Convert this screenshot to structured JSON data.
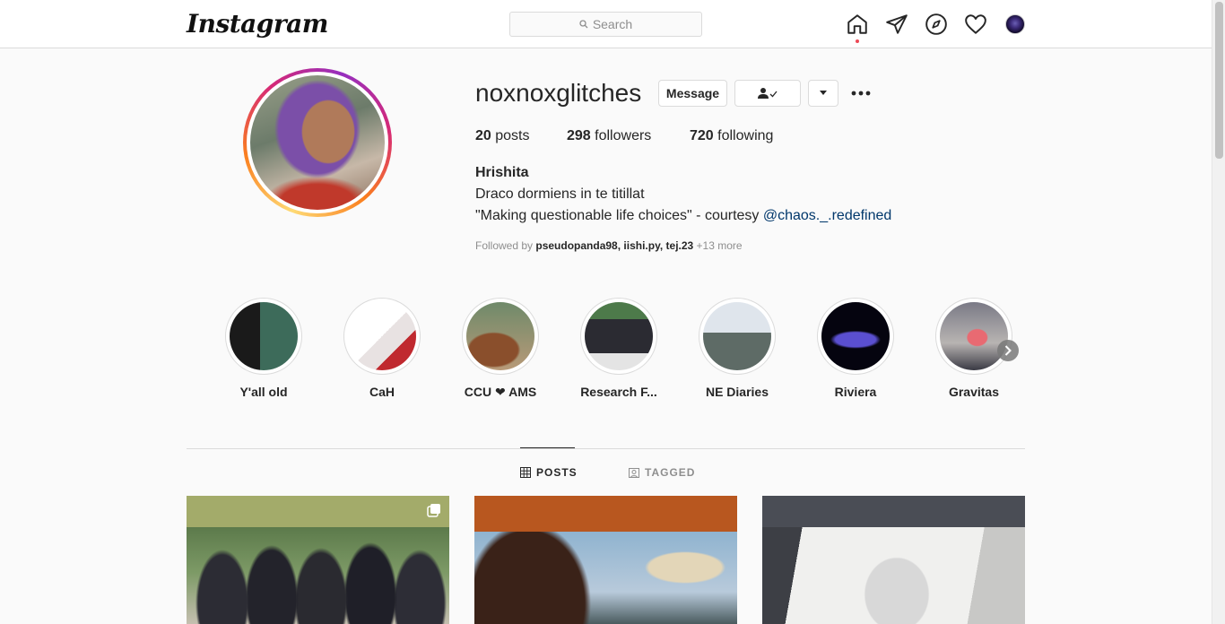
{
  "topbar": {
    "logo": "Instagram",
    "search_placeholder": "Search",
    "icons": [
      "home-icon",
      "direct-icon",
      "explore-icon",
      "activity-icon",
      "profile-avatar"
    ]
  },
  "profile": {
    "username": "noxnoxglitches",
    "buttons": {
      "message": "Message"
    },
    "stats": {
      "posts_count": "20",
      "posts_label": "posts",
      "followers_count": "298",
      "followers_label": "followers",
      "following_count": "720",
      "following_label": "following"
    },
    "full_name": "Hrishita",
    "bio_line1": "Draco dormiens in te titillat",
    "bio_line2_prefix": "\"Making questionable life choices\" - courtesy",
    "bio_mention": "@chaos._.redefined",
    "followed_by": {
      "prefix": "Followed by",
      "users": "pseudopanda98, iishi.py, tej.23",
      "more": "+13 more"
    }
  },
  "highlights": [
    {
      "label": "Y'all old"
    },
    {
      "label": "CaH"
    },
    {
      "label": "CCU ❤ AMS"
    },
    {
      "label": "Research F..."
    },
    {
      "label": "NE Diaries"
    },
    {
      "label": "Riviera"
    },
    {
      "label": "Gravitas"
    }
  ],
  "tabs": {
    "posts": "POSTS",
    "tagged": "TAGGED"
  },
  "colors": {
    "accent_link": "#00376b",
    "notification_dot": "#ed4956",
    "border": "#dbdbdb"
  }
}
